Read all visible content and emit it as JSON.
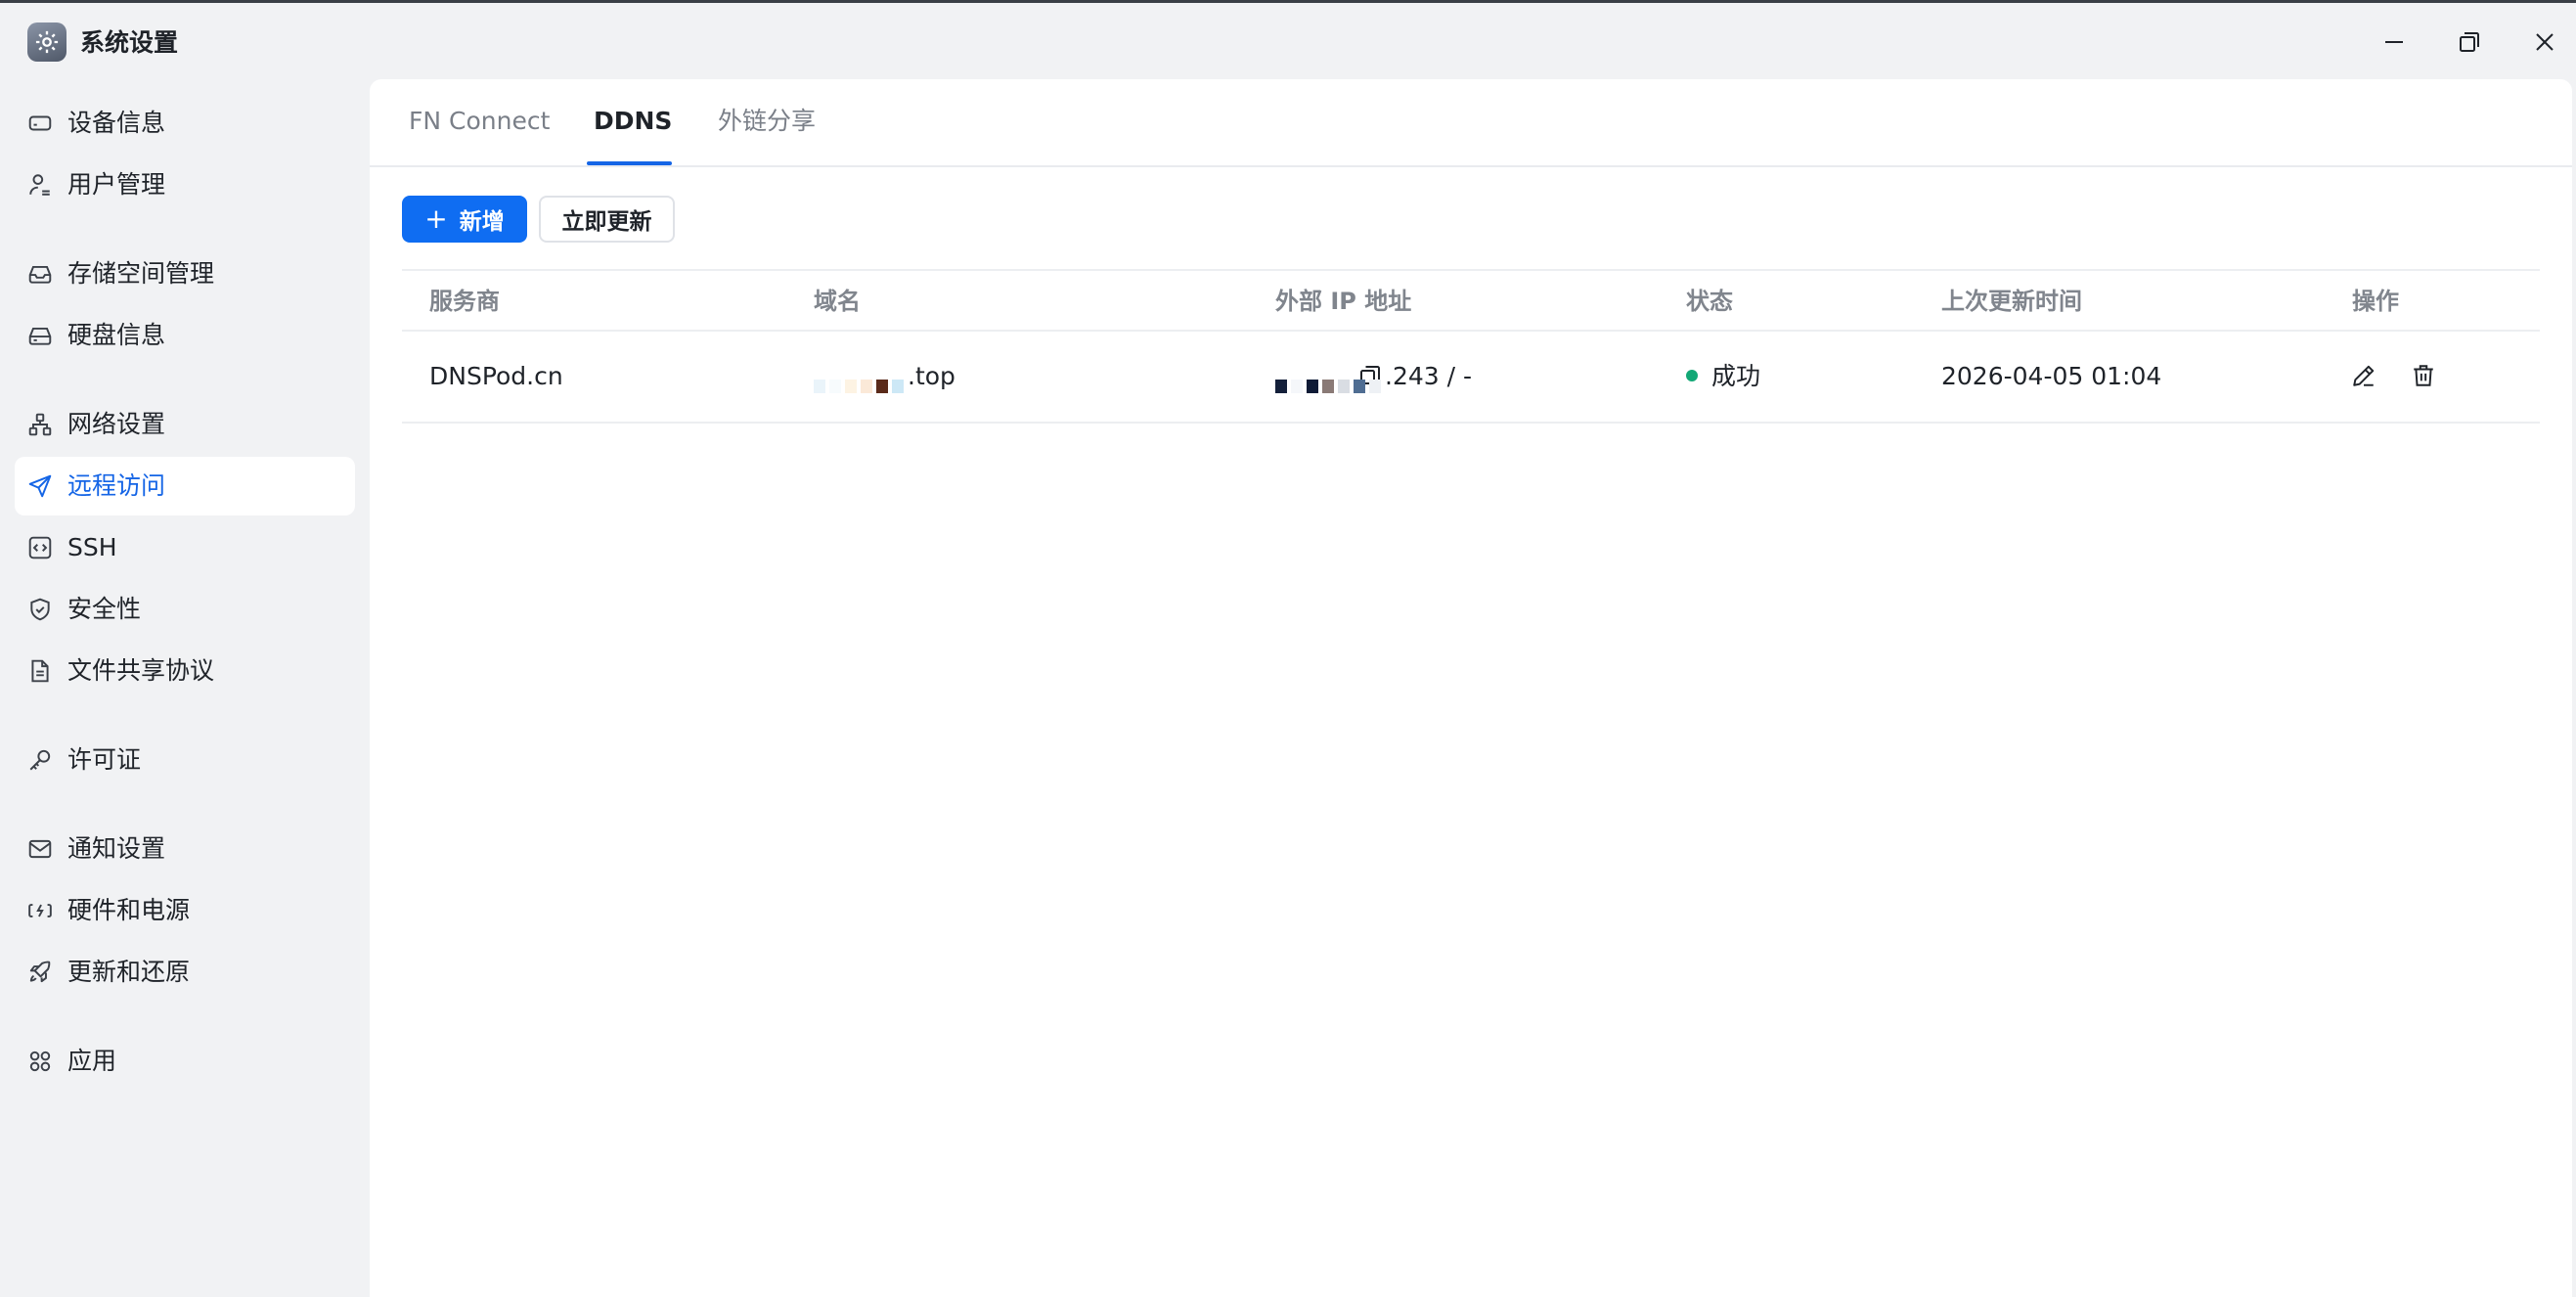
{
  "window": {
    "title": "系统设置",
    "app_icon": "gear-icon",
    "controls": [
      "minimize-icon",
      "maximize-icon",
      "close-icon"
    ]
  },
  "sidebar": {
    "items": [
      {
        "label": "设备信息",
        "icon": "device-icon"
      },
      {
        "label": "用户管理",
        "icon": "user-icon"
      },
      {
        "label": "存储空间管理",
        "icon": "storage-icon"
      },
      {
        "label": "硬盘信息",
        "icon": "disk-icon"
      },
      {
        "label": "网络设置",
        "icon": "network-icon"
      },
      {
        "label": "远程访问",
        "icon": "send-icon",
        "active": true
      },
      {
        "label": "SSH",
        "icon": "code-icon"
      },
      {
        "label": "安全性",
        "icon": "shield-icon"
      },
      {
        "label": "文件共享协议",
        "icon": "document-icon"
      },
      {
        "label": "许可证",
        "icon": "key-icon"
      },
      {
        "label": "通知设置",
        "icon": "mail-icon"
      },
      {
        "label": "硬件和电源",
        "icon": "power-icon"
      },
      {
        "label": "更新和还原",
        "icon": "rocket-icon"
      },
      {
        "label": "应用",
        "icon": "apps-icon"
      }
    ]
  },
  "tabs": [
    {
      "label": "FN Connect"
    },
    {
      "label": "DDNS",
      "active": true
    },
    {
      "label": "外链分享"
    }
  ],
  "toolbar": {
    "add_label": "新增",
    "update_now_label": "立即更新"
  },
  "table": {
    "headers": [
      "服务商",
      "域名",
      "外部 IP 地址",
      "状态",
      "上次更新时间",
      "操作"
    ],
    "rows": [
      {
        "provider": "DNSPod.cn",
        "domain_suffix": ".top",
        "ip_suffix": ".243 / -",
        "status": "成功",
        "last_update": "2026-04-05 01:04"
      }
    ]
  },
  "colors": {
    "accent": "#1565e6",
    "primary_button": "#0f6df2",
    "success": "#13a876"
  }
}
